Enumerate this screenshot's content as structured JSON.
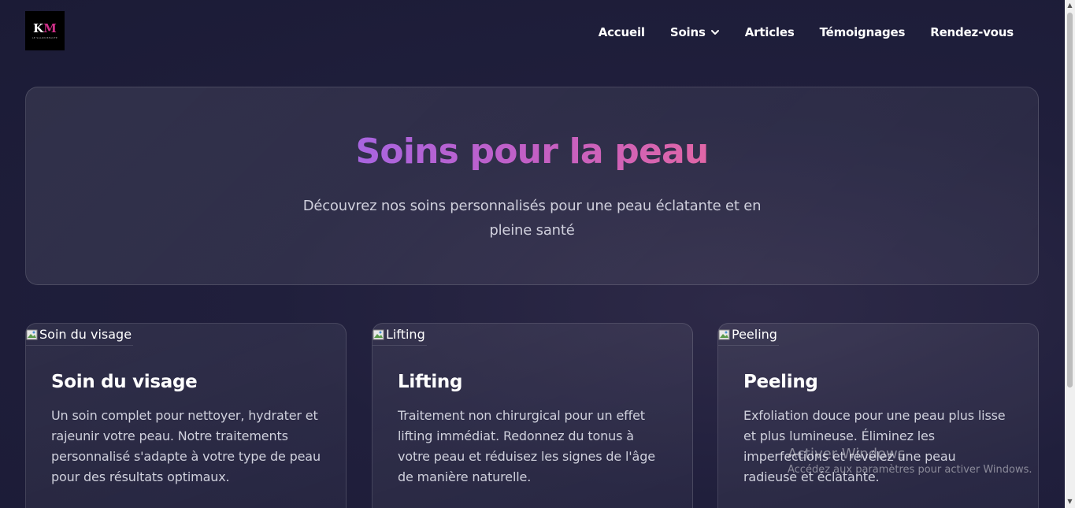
{
  "logo": {
    "monogram_k": "K",
    "monogram_m": "M",
    "tagline": "LE SALON BEAUTE"
  },
  "nav": [
    {
      "label": "Accueil"
    },
    {
      "label": "Soins",
      "has_dropdown": true
    },
    {
      "label": "Articles"
    },
    {
      "label": "Témoignages"
    },
    {
      "label": "Rendez-vous"
    }
  ],
  "hero": {
    "title": "Soins pour la peau",
    "subtitle": "Découvrez nos soins personnalisés pour une peau éclatante et en pleine santé"
  },
  "cards": [
    {
      "image_alt": "Soin du visage",
      "title": "Soin du visage",
      "text": "Un soin complet pour nettoyer, hydrater et rajeunir votre peau. Notre traitements personnalisé s'adapte à votre type de peau pour des résultats optimaux."
    },
    {
      "image_alt": "Lifting",
      "title": "Lifting",
      "text": "Traitement non chirurgical pour un effet lifting immédiat. Redonnez du tonus à votre peau et réduisez les signes de l'âge de manière naturelle."
    },
    {
      "image_alt": "Peeling",
      "title": "Peeling",
      "text": "Exfoliation douce pour une peau plus lisse et plus lumineuse. Éliminez les imperfections et révélez une peau radieuse et éclatante."
    }
  ],
  "watermark": {
    "line1": "Activer Windows",
    "line2": "Accédez aux paramètres pour activer Windows."
  },
  "colors": {
    "background": "#1e1e3a",
    "title_gradient_start": "#a865e0",
    "title_gradient_end": "#e066a6",
    "logo_accent": "#d0308a"
  }
}
